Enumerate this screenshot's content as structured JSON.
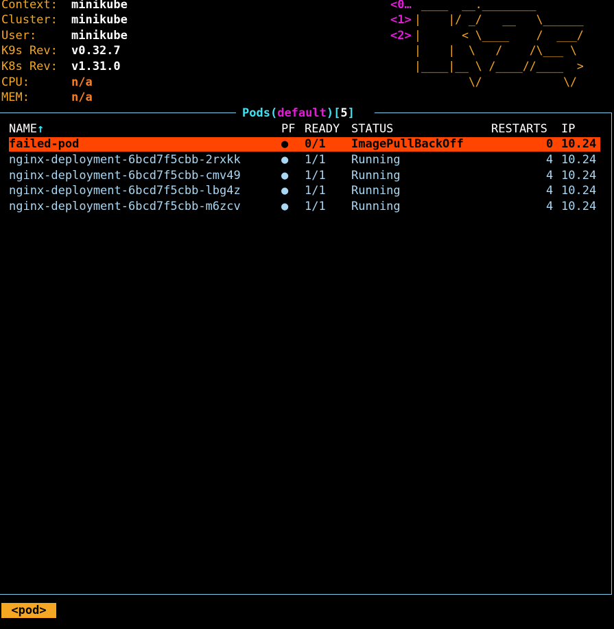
{
  "info": {
    "context_label": "Context:",
    "context_value": "minikube",
    "cluster_label": "Cluster:",
    "cluster_value": "minikube",
    "user_label": "User:",
    "user_value": "minikube",
    "k9s_rev_label": "K9s Rev:",
    "k9s_rev_value": "v0.32.7",
    "k8s_rev_label": "K8s Rev:",
    "k8s_rev_value": "v1.31.0",
    "cpu_label": "CPU:",
    "cpu_value": "n/a",
    "mem_label": "MEM:",
    "mem_value": "n/a"
  },
  "hotkeys": [
    "<0…",
    "<1>",
    "<2>"
  ],
  "logo_lines": [
    " ____  __.________       ",
    "|    |/ _/   __   \\______",
    "|      < \\____    /  ___/",
    "|    |  \\   /    /\\___ \\ ",
    "|____|__ \\ /____//____  >",
    "        \\/            \\/ "
  ],
  "panel": {
    "resource": "Pods",
    "namespace": "default",
    "count": "5",
    "open_paren": "(",
    "close_paren": ")",
    "open_bracket": "[",
    "close_bracket": "]"
  },
  "table": {
    "headers": {
      "name": "NAME",
      "sort_arrow": "↑",
      "pf": "PF",
      "ready": "READY",
      "status": "STATUS",
      "restarts": "RESTARTS",
      "ip": "IP"
    },
    "rows": [
      {
        "name": "failed-pod",
        "pf": "●",
        "ready": "0/1",
        "status": "ImagePullBackOff",
        "restarts": "0",
        "ip": "10.24"
      },
      {
        "name": "nginx-deployment-6bcd7f5cbb-2rxkk",
        "pf": "●",
        "ready": "1/1",
        "status": "Running",
        "restarts": "4",
        "ip": "10.24"
      },
      {
        "name": "nginx-deployment-6bcd7f5cbb-cmv49",
        "pf": "●",
        "ready": "1/1",
        "status": "Running",
        "restarts": "4",
        "ip": "10.24"
      },
      {
        "name": "nginx-deployment-6bcd7f5cbb-lbg4z",
        "pf": "●",
        "ready": "1/1",
        "status": "Running",
        "restarts": "4",
        "ip": "10.24"
      },
      {
        "name": "nginx-deployment-6bcd7f5cbb-m6zcv",
        "pf": "●",
        "ready": "1/1",
        "status": "Running",
        "restarts": "4",
        "ip": "10.24"
      }
    ]
  },
  "crumbs": [
    "<pod>"
  ],
  "colors": {
    "label": "#f5a623",
    "hotkey": "#e21bd8",
    "frame": "#7fd0ee",
    "row_text": "#a8d6f3",
    "selected_row_bg": "#ff4500",
    "crumb_bg": "#f5a623"
  }
}
